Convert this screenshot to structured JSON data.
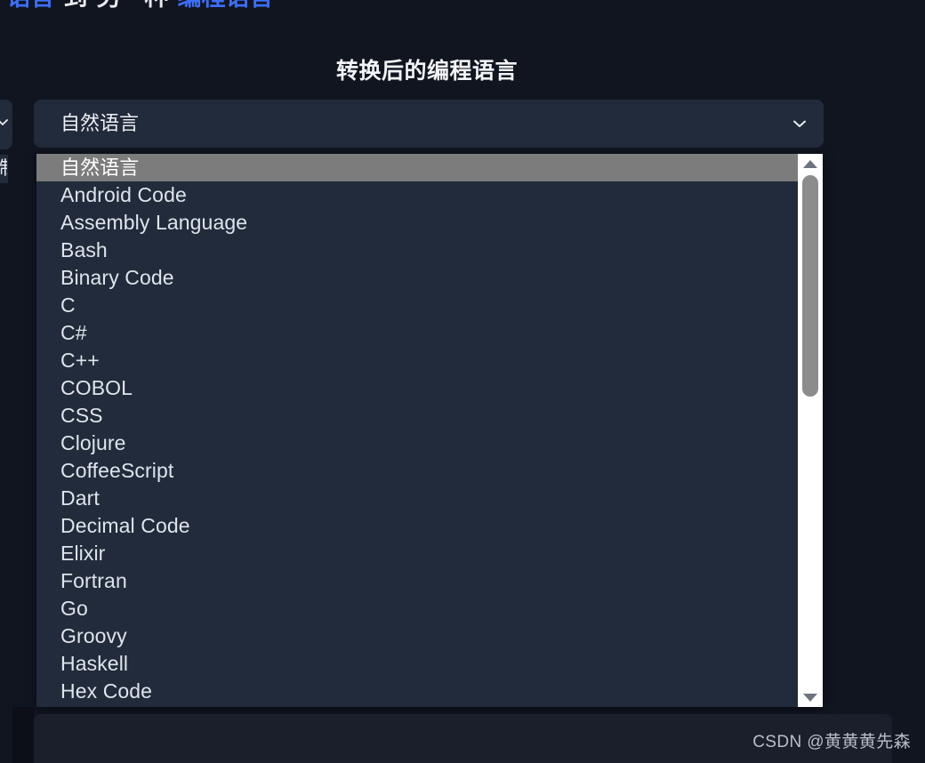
{
  "page": {
    "background_color": "#111520",
    "accent_color": "#3b6ef6",
    "panel_color": "#212b3b",
    "highlight_color": "#7c7c7c"
  },
  "top_heading": {
    "note": "clipped line of text running off the top edge of the viewport",
    "segment_1": "语言",
    "segment_2": "到",
    "segment_3": "另一种",
    "segment_4": "编程语言"
  },
  "section": {
    "title": "转换后的编程语言"
  },
  "target_language_select": {
    "name": "target-language-select",
    "selected_value": "自然语言",
    "placeholder": "自然语言",
    "chevron_icon": "chevron-down-icon",
    "expanded": true
  },
  "left_partial_select": {
    "chevron_icon": "chevron-down-icon",
    "clipped_text_fragment": "制"
  },
  "language_listbox": {
    "selected_index": 0,
    "options": [
      "自然语言",
      "Android Code",
      "Assembly Language",
      "Bash",
      "Binary Code",
      "C",
      "C#",
      "C++",
      "COBOL",
      "CSS",
      "Clojure",
      "CoffeeScript",
      "Dart",
      "Decimal Code",
      "Elixir",
      "Fortran",
      "Go",
      "Groovy",
      "Haskell",
      "Hex Code"
    ],
    "scrollbar": {
      "up_arrow_icon": "triangle-up-icon",
      "down_arrow_icon": "triangle-down-icon",
      "thumb_position_percent": 0,
      "thumb_size_percent": 43
    }
  },
  "watermark": {
    "text": "CSDN @黄黄黄先森"
  }
}
